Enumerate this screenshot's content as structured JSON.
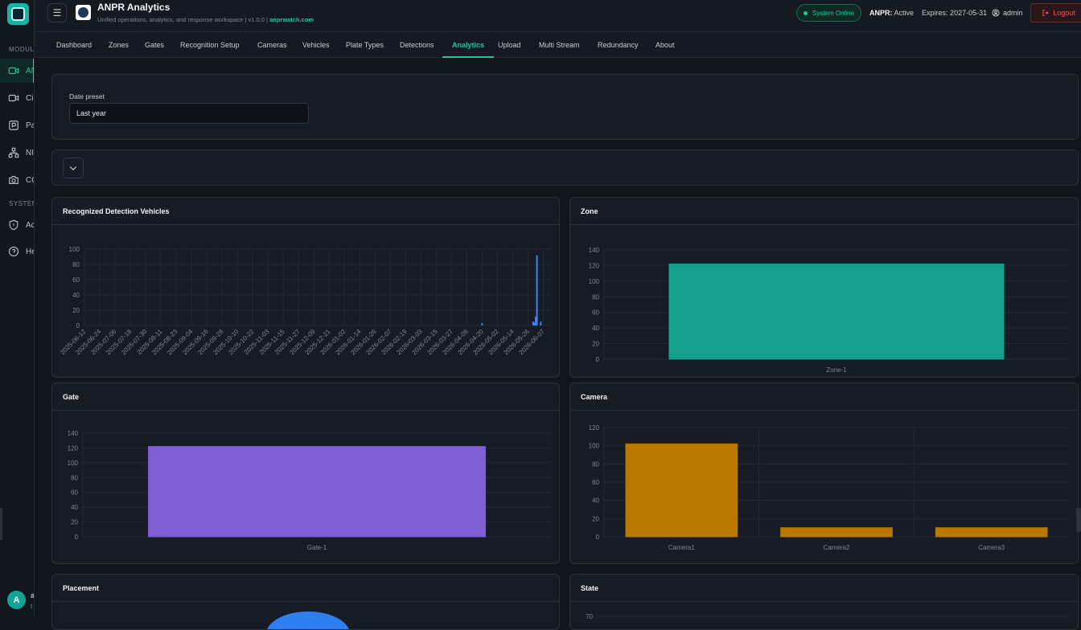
{
  "sidebar": {
    "section_modules": "MODULE",
    "section_system": "SYSTEM",
    "items": [
      {
        "label": "AN",
        "icon": "camera-icon"
      },
      {
        "label": "Ci",
        "icon": "camera-icon"
      },
      {
        "label": "Pa",
        "icon": "parking-icon"
      },
      {
        "label": "NI",
        "icon": "network-icon"
      },
      {
        "label": "CC",
        "icon": "photo-camera-icon"
      },
      {
        "label": "Ac",
        "icon": "shield-icon"
      },
      {
        "label": "He",
        "icon": "help-icon"
      }
    ],
    "user_initial": "A",
    "user_name": "a",
    "user_sub": "t"
  },
  "header": {
    "title": "ANPR Analytics",
    "subtitle": "Unified operations, analytics, and response workspace",
    "version": "v1.0.0",
    "site_link": "anprwatch.com",
    "status": "System Online",
    "license_label": "ANPR:",
    "license_state": "Active",
    "expires": "Expires: 2027-05-31",
    "user": "admin",
    "logout": "Logout"
  },
  "tabs": [
    "Dashboard",
    "Zones",
    "Gates",
    "Recognition Setup",
    "Cameras",
    "Vehicles",
    "Plate Types",
    "Detections",
    "Analytics",
    "Upload",
    "Multi Stream",
    "Redundancy",
    "About"
  ],
  "active_tab": "Analytics",
  "filters": {
    "date_preset_label": "Date preset",
    "date_preset_value": "Last year"
  },
  "cards": {
    "recognized": "Recognized Detection Vehicles",
    "zone": "Zone",
    "gate": "Gate",
    "camera": "Camera",
    "placement": "Placement",
    "state": "State"
  },
  "colors": {
    "accent": "#22c59a",
    "detections_bar": "#3b82f6",
    "zone_bar": "#14a08d",
    "gate_bar": "#7f5fd4",
    "camera_bar": "#b97800",
    "placement_slice": "#2f7ef0"
  },
  "chart_data": [
    {
      "type": "bar",
      "title": "Recognized Detection Vehicles",
      "categories": [
        "2025-06-12",
        "2025-06-24",
        "2025-07-06",
        "2025-07-18",
        "2025-07-30",
        "2025-08-11",
        "2025-08-23",
        "2025-09-04",
        "2025-09-16",
        "2025-09-28",
        "2025-10-10",
        "2025-10-22",
        "2025-11-03",
        "2025-11-15",
        "2025-11-27",
        "2025-12-09",
        "2025-12-21",
        "2026-01-02",
        "2026-01-14",
        "2026-01-26",
        "2026-02-07",
        "2026-02-19",
        "2026-03-03",
        "2026-03-15",
        "2026-03-27",
        "2026-04-08",
        "2026-04-20",
        "2026-05-02",
        "2026-05-14",
        "2026-05-26",
        "2026-06-07"
      ],
      "points": [
        {
          "x": "2026-04-20",
          "y": 3
        },
        {
          "x": "2026-05-30",
          "y": 5
        },
        {
          "x": "2026-05-31",
          "y": 4
        },
        {
          "x": "2026-06-01",
          "y": 12
        },
        {
          "x": "2026-06-02",
          "y": 92
        },
        {
          "x": "2026-06-05",
          "y": 5
        }
      ],
      "ylim": [
        0,
        100
      ],
      "yticks": [
        0,
        20,
        40,
        60,
        80,
        100
      ],
      "grid": true
    },
    {
      "type": "bar",
      "title": "Zone",
      "categories": [
        "Zone-1"
      ],
      "values": [
        122
      ],
      "ylim": [
        0,
        140
      ],
      "yticks": [
        0,
        20,
        40,
        60,
        80,
        100,
        120,
        140
      ],
      "grid": true
    },
    {
      "type": "bar",
      "title": "Gate",
      "categories": [
        "Gate-1"
      ],
      "values": [
        122
      ],
      "ylim": [
        0,
        140
      ],
      "yticks": [
        0,
        20,
        40,
        60,
        80,
        100,
        120,
        140
      ],
      "grid": true
    },
    {
      "type": "bar",
      "title": "Camera",
      "categories": [
        "Camera1",
        "Camera2",
        "Camera3"
      ],
      "values": [
        102,
        10,
        10
      ],
      "ylim": [
        0,
        120
      ],
      "yticks": [
        0,
        20,
        40,
        60,
        80,
        100,
        120
      ],
      "grid": true
    },
    {
      "type": "pie",
      "title": "Placement",
      "categories": [],
      "values": []
    },
    {
      "type": "bar",
      "title": "State",
      "categories": [],
      "values": [],
      "yticks": [
        70
      ]
    }
  ]
}
